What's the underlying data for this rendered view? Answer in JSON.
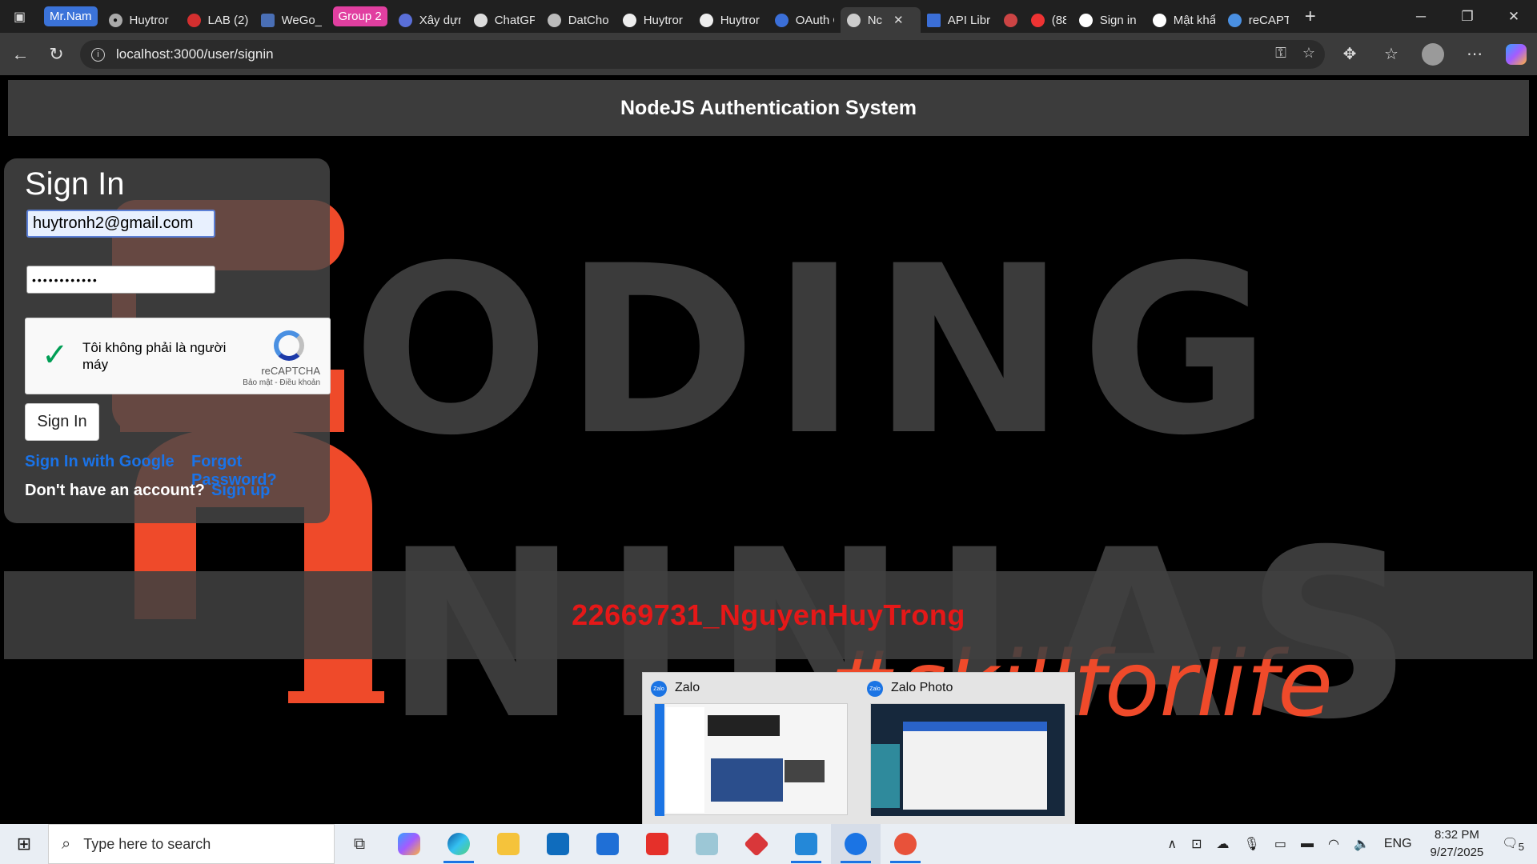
{
  "browser": {
    "group_labels": [
      "Mr.Nam",
      "Group 2"
    ],
    "tabs": [
      {
        "label": "Huytror"
      },
      {
        "label": "LAB (2)."
      },
      {
        "label": "WeGo_u"
      },
      {
        "label": "Xây dựn"
      },
      {
        "label": "ChatGP"
      },
      {
        "label": "DatCho"
      },
      {
        "label": "Huytror"
      },
      {
        "label": "Huytror"
      },
      {
        "label": "OAuth C"
      },
      {
        "label": "Nc",
        "active": true
      },
      {
        "label": "API Libr"
      },
      {
        "label": ""
      },
      {
        "label": "(88"
      },
      {
        "label": "Sign in"
      },
      {
        "label": "Mật khẩ"
      },
      {
        "label": "reCAPT("
      }
    ],
    "url": "localhost:3000/user/signin"
  },
  "app": {
    "header_title": "NodeJS Authentication System",
    "signin": {
      "title": "Sign In",
      "email_value": "huytronh2@gmail.com",
      "password_mask": "••••••••••••",
      "captcha_label": "Tôi không phải là người máy",
      "captcha_brand": "reCAPTCHA",
      "captcha_terms": "Bảo mật - Điều khoản",
      "button": "Sign In",
      "google_link": "Sign In with Google",
      "forgot_link": "Forgot Password?",
      "no_account": "Don't have an account?",
      "signup_link": "Sign up"
    },
    "footer": "22669731_NguyenHuyTrong",
    "bg_words": [
      "ODING",
      "NINJAS",
      "#skillforlife"
    ]
  },
  "preview": {
    "items": [
      {
        "title": "Zalo"
      },
      {
        "title": "Zalo Photo"
      }
    ]
  },
  "taskbar": {
    "search_placeholder": "Type here to search",
    "time": "8:32 PM",
    "date": "9/27/2025",
    "lang": "ENG",
    "notif_count": "5"
  },
  "colors": {
    "accent_red": "#ef4a2a",
    "link_blue": "#1a73e8",
    "footer_red": "#e51818"
  }
}
